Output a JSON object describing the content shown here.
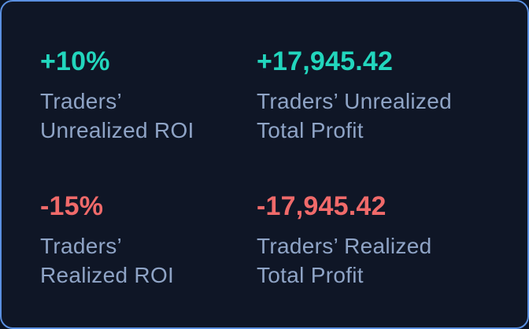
{
  "stats": [
    {
      "value": "+10%",
      "label_line1": "Traders’",
      "label_line2": "Unrealized ROI",
      "tone": "positive"
    },
    {
      "value": "+17,945.42",
      "label_line1": "Traders’ Unrealized",
      "label_line2": "Total Profit",
      "tone": "positive"
    },
    {
      "value": "-15%",
      "label_line1": "Traders’",
      "label_line2": "Realized ROI",
      "tone": "negative"
    },
    {
      "value": "-17,945.42",
      "label_line1": "Traders’ Realized",
      "label_line2": "Total Profit",
      "tone": "negative"
    }
  ],
  "colors": {
    "positive": "#22d6bd",
    "negative": "#f06a6a",
    "label": "#8fa4c6",
    "background": "#0f1626",
    "border": "#5a8fe0"
  }
}
